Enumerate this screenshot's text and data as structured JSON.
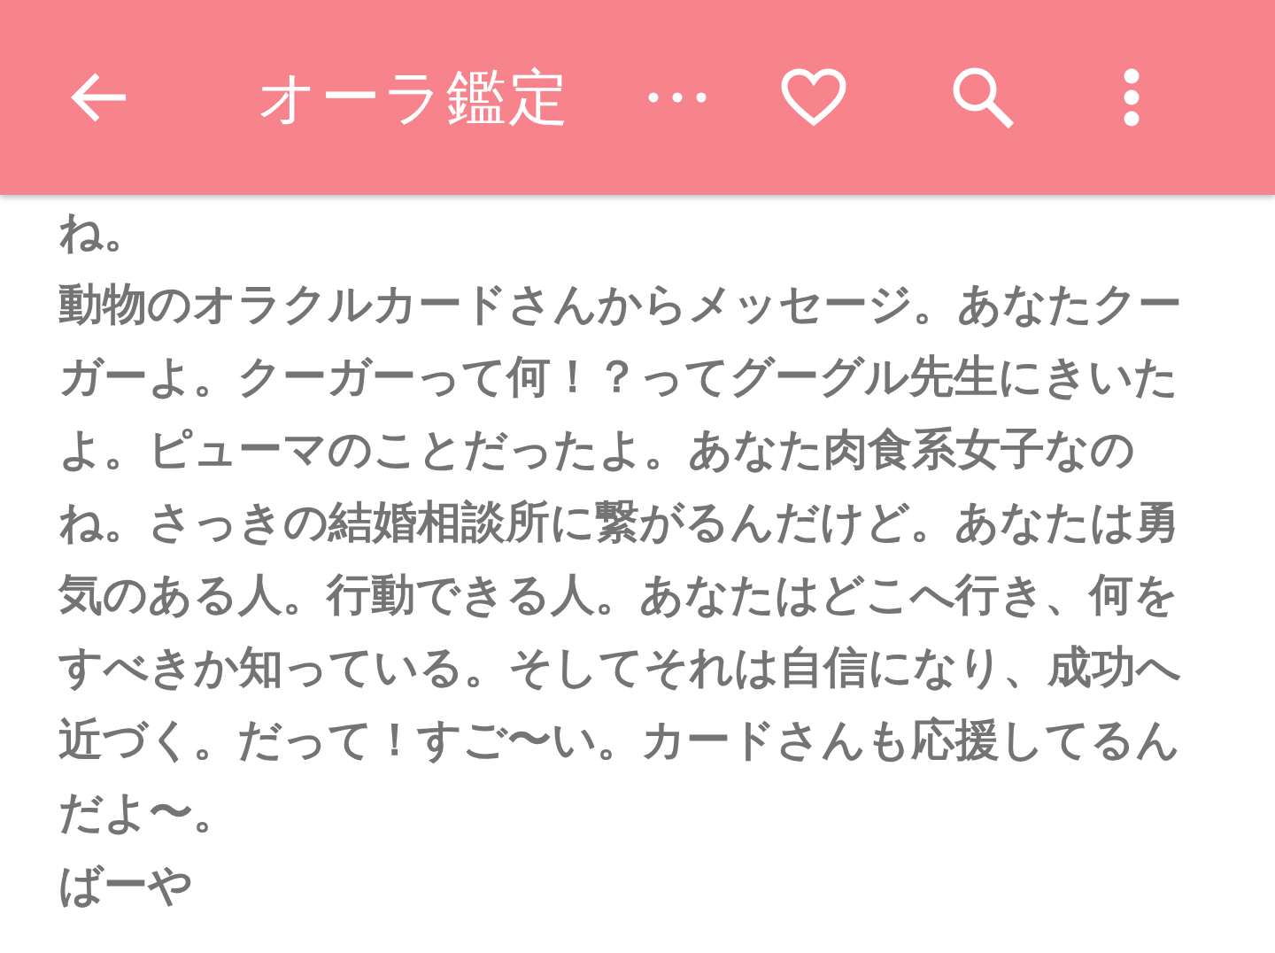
{
  "app_bar": {
    "title": "オーラ鑑定"
  },
  "message": {
    "lines": [
      "ね。",
      "動物のオラクルカードさんからメッセージ。あなたクーガーよ。クーガーって何！？ってグーグル先生にきいたよ。ピューマのことだったよ。あなた肉食系女子なのね。さっきの結婚相談所に繋がるんだけど。あなたは勇気のある人。行動できる人。あなたはどこへ行き、何をすべきか知っている。そしてそれは自信になり、成功へ近づく。だって！すご〜い。カードさんも応援してるんだよ〜。",
      "ばーや"
    ]
  }
}
